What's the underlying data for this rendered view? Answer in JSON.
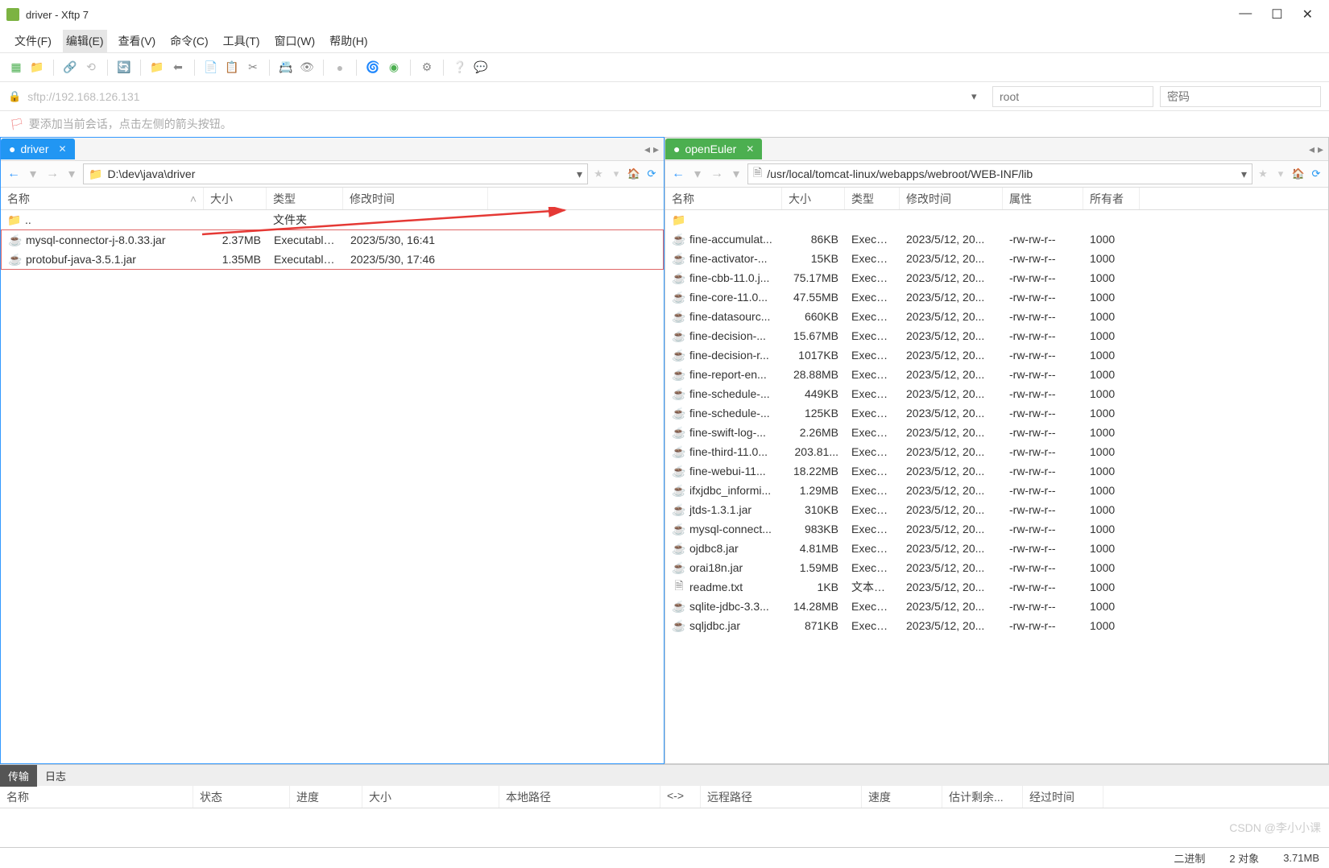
{
  "window": {
    "title": "driver - Xftp 7"
  },
  "menu": {
    "file": "文件(F)",
    "edit": "编辑(E)",
    "view": "查看(V)",
    "cmd": "命令(C)",
    "tool": "工具(T)",
    "window": "窗口(W)",
    "help": "帮助(H)"
  },
  "address": {
    "url": "sftp://192.168.126.131",
    "user_placeholder": "root",
    "pass_placeholder": "密码"
  },
  "session_hint": "要添加当前会话，点击左侧的箭头按钮。",
  "left_pane": {
    "tab": "driver",
    "path": "D:\\dev\\java\\driver",
    "cols": {
      "name": "名称",
      "size": "大小",
      "type": "类型",
      "modified": "修改时间"
    },
    "parent_row": {
      "name": "..",
      "type": "文件夹"
    },
    "files": [
      {
        "name": "mysql-connector-j-8.0.33.jar",
        "size": "2.37MB",
        "type": "Executable...",
        "modified": "2023/5/30, 16:41"
      },
      {
        "name": "protobuf-java-3.5.1.jar",
        "size": "1.35MB",
        "type": "Executable...",
        "modified": "2023/5/30, 17:46"
      }
    ]
  },
  "right_pane": {
    "tab": "openEuler",
    "path": "/usr/local/tomcat-linux/webapps/webroot/WEB-INF/lib",
    "cols": {
      "name": "名称",
      "size": "大小",
      "type": "类型",
      "modified": "修改时间",
      "attr": "属性",
      "owner": "所有者"
    },
    "files": [
      {
        "name": "fine-accumulat...",
        "size": "86KB",
        "type": "Execut...",
        "modified": "2023/5/12, 20...",
        "attr": "-rw-rw-r--",
        "owner": "1000"
      },
      {
        "name": "fine-activator-...",
        "size": "15KB",
        "type": "Execut...",
        "modified": "2023/5/12, 20...",
        "attr": "-rw-rw-r--",
        "owner": "1000"
      },
      {
        "name": "fine-cbb-11.0.j...",
        "size": "75.17MB",
        "type": "Execut...",
        "modified": "2023/5/12, 20...",
        "attr": "-rw-rw-r--",
        "owner": "1000"
      },
      {
        "name": "fine-core-11.0...",
        "size": "47.55MB",
        "type": "Execut...",
        "modified": "2023/5/12, 20...",
        "attr": "-rw-rw-r--",
        "owner": "1000"
      },
      {
        "name": "fine-datasourc...",
        "size": "660KB",
        "type": "Execut...",
        "modified": "2023/5/12, 20...",
        "attr": "-rw-rw-r--",
        "owner": "1000"
      },
      {
        "name": "fine-decision-...",
        "size": "15.67MB",
        "type": "Execut...",
        "modified": "2023/5/12, 20...",
        "attr": "-rw-rw-r--",
        "owner": "1000"
      },
      {
        "name": "fine-decision-r...",
        "size": "1017KB",
        "type": "Execut...",
        "modified": "2023/5/12, 20...",
        "attr": "-rw-rw-r--",
        "owner": "1000"
      },
      {
        "name": "fine-report-en...",
        "size": "28.88MB",
        "type": "Execut...",
        "modified": "2023/5/12, 20...",
        "attr": "-rw-rw-r--",
        "owner": "1000"
      },
      {
        "name": "fine-schedule-...",
        "size": "449KB",
        "type": "Execut...",
        "modified": "2023/5/12, 20...",
        "attr": "-rw-rw-r--",
        "owner": "1000"
      },
      {
        "name": "fine-schedule-...",
        "size": "125KB",
        "type": "Execut...",
        "modified": "2023/5/12, 20...",
        "attr": "-rw-rw-r--",
        "owner": "1000"
      },
      {
        "name": "fine-swift-log-...",
        "size": "2.26MB",
        "type": "Execut...",
        "modified": "2023/5/12, 20...",
        "attr": "-rw-rw-r--",
        "owner": "1000"
      },
      {
        "name": "fine-third-11.0...",
        "size": "203.81...",
        "type": "Execut...",
        "modified": "2023/5/12, 20...",
        "attr": "-rw-rw-r--",
        "owner": "1000"
      },
      {
        "name": "fine-webui-11...",
        "size": "18.22MB",
        "type": "Execut...",
        "modified": "2023/5/12, 20...",
        "attr": "-rw-rw-r--",
        "owner": "1000"
      },
      {
        "name": "ifxjdbc_informi...",
        "size": "1.29MB",
        "type": "Execut...",
        "modified": "2023/5/12, 20...",
        "attr": "-rw-rw-r--",
        "owner": "1000"
      },
      {
        "name": "jtds-1.3.1.jar",
        "size": "310KB",
        "type": "Execut...",
        "modified": "2023/5/12, 20...",
        "attr": "-rw-rw-r--",
        "owner": "1000"
      },
      {
        "name": "mysql-connect...",
        "size": "983KB",
        "type": "Execut...",
        "modified": "2023/5/12, 20...",
        "attr": "-rw-rw-r--",
        "owner": "1000"
      },
      {
        "name": "ojdbc8.jar",
        "size": "4.81MB",
        "type": "Execut...",
        "modified": "2023/5/12, 20...",
        "attr": "-rw-rw-r--",
        "owner": "1000"
      },
      {
        "name": "orai18n.jar",
        "size": "1.59MB",
        "type": "Execut...",
        "modified": "2023/5/12, 20...",
        "attr": "-rw-rw-r--",
        "owner": "1000"
      },
      {
        "name": "readme.txt",
        "size": "1KB",
        "type": "文本文档",
        "modified": "2023/5/12, 20...",
        "attr": "-rw-rw-r--",
        "owner": "1000",
        "icon": "txt"
      },
      {
        "name": "sqlite-jdbc-3.3...",
        "size": "14.28MB",
        "type": "Execut...",
        "modified": "2023/5/12, 20...",
        "attr": "-rw-rw-r--",
        "owner": "1000"
      },
      {
        "name": "sqljdbc.jar",
        "size": "871KB",
        "type": "Execut...",
        "modified": "2023/5/12, 20...",
        "attr": "-rw-rw-r--",
        "owner": "1000"
      }
    ]
  },
  "bottom_tabs": {
    "transfer": "传输",
    "log": "日志"
  },
  "transfer_cols": {
    "name": "名称",
    "status": "状态",
    "progress": "进度",
    "size": "大小",
    "local": "本地路径",
    "dir": "<->",
    "remote": "远程路径",
    "speed": "速度",
    "eta": "估计剩余...",
    "elapsed": "经过时间"
  },
  "status": {
    "binary": "二进制",
    "objects": "2 对象",
    "total_size": "3.71MB"
  },
  "watermark": "CSDN @李小小课"
}
